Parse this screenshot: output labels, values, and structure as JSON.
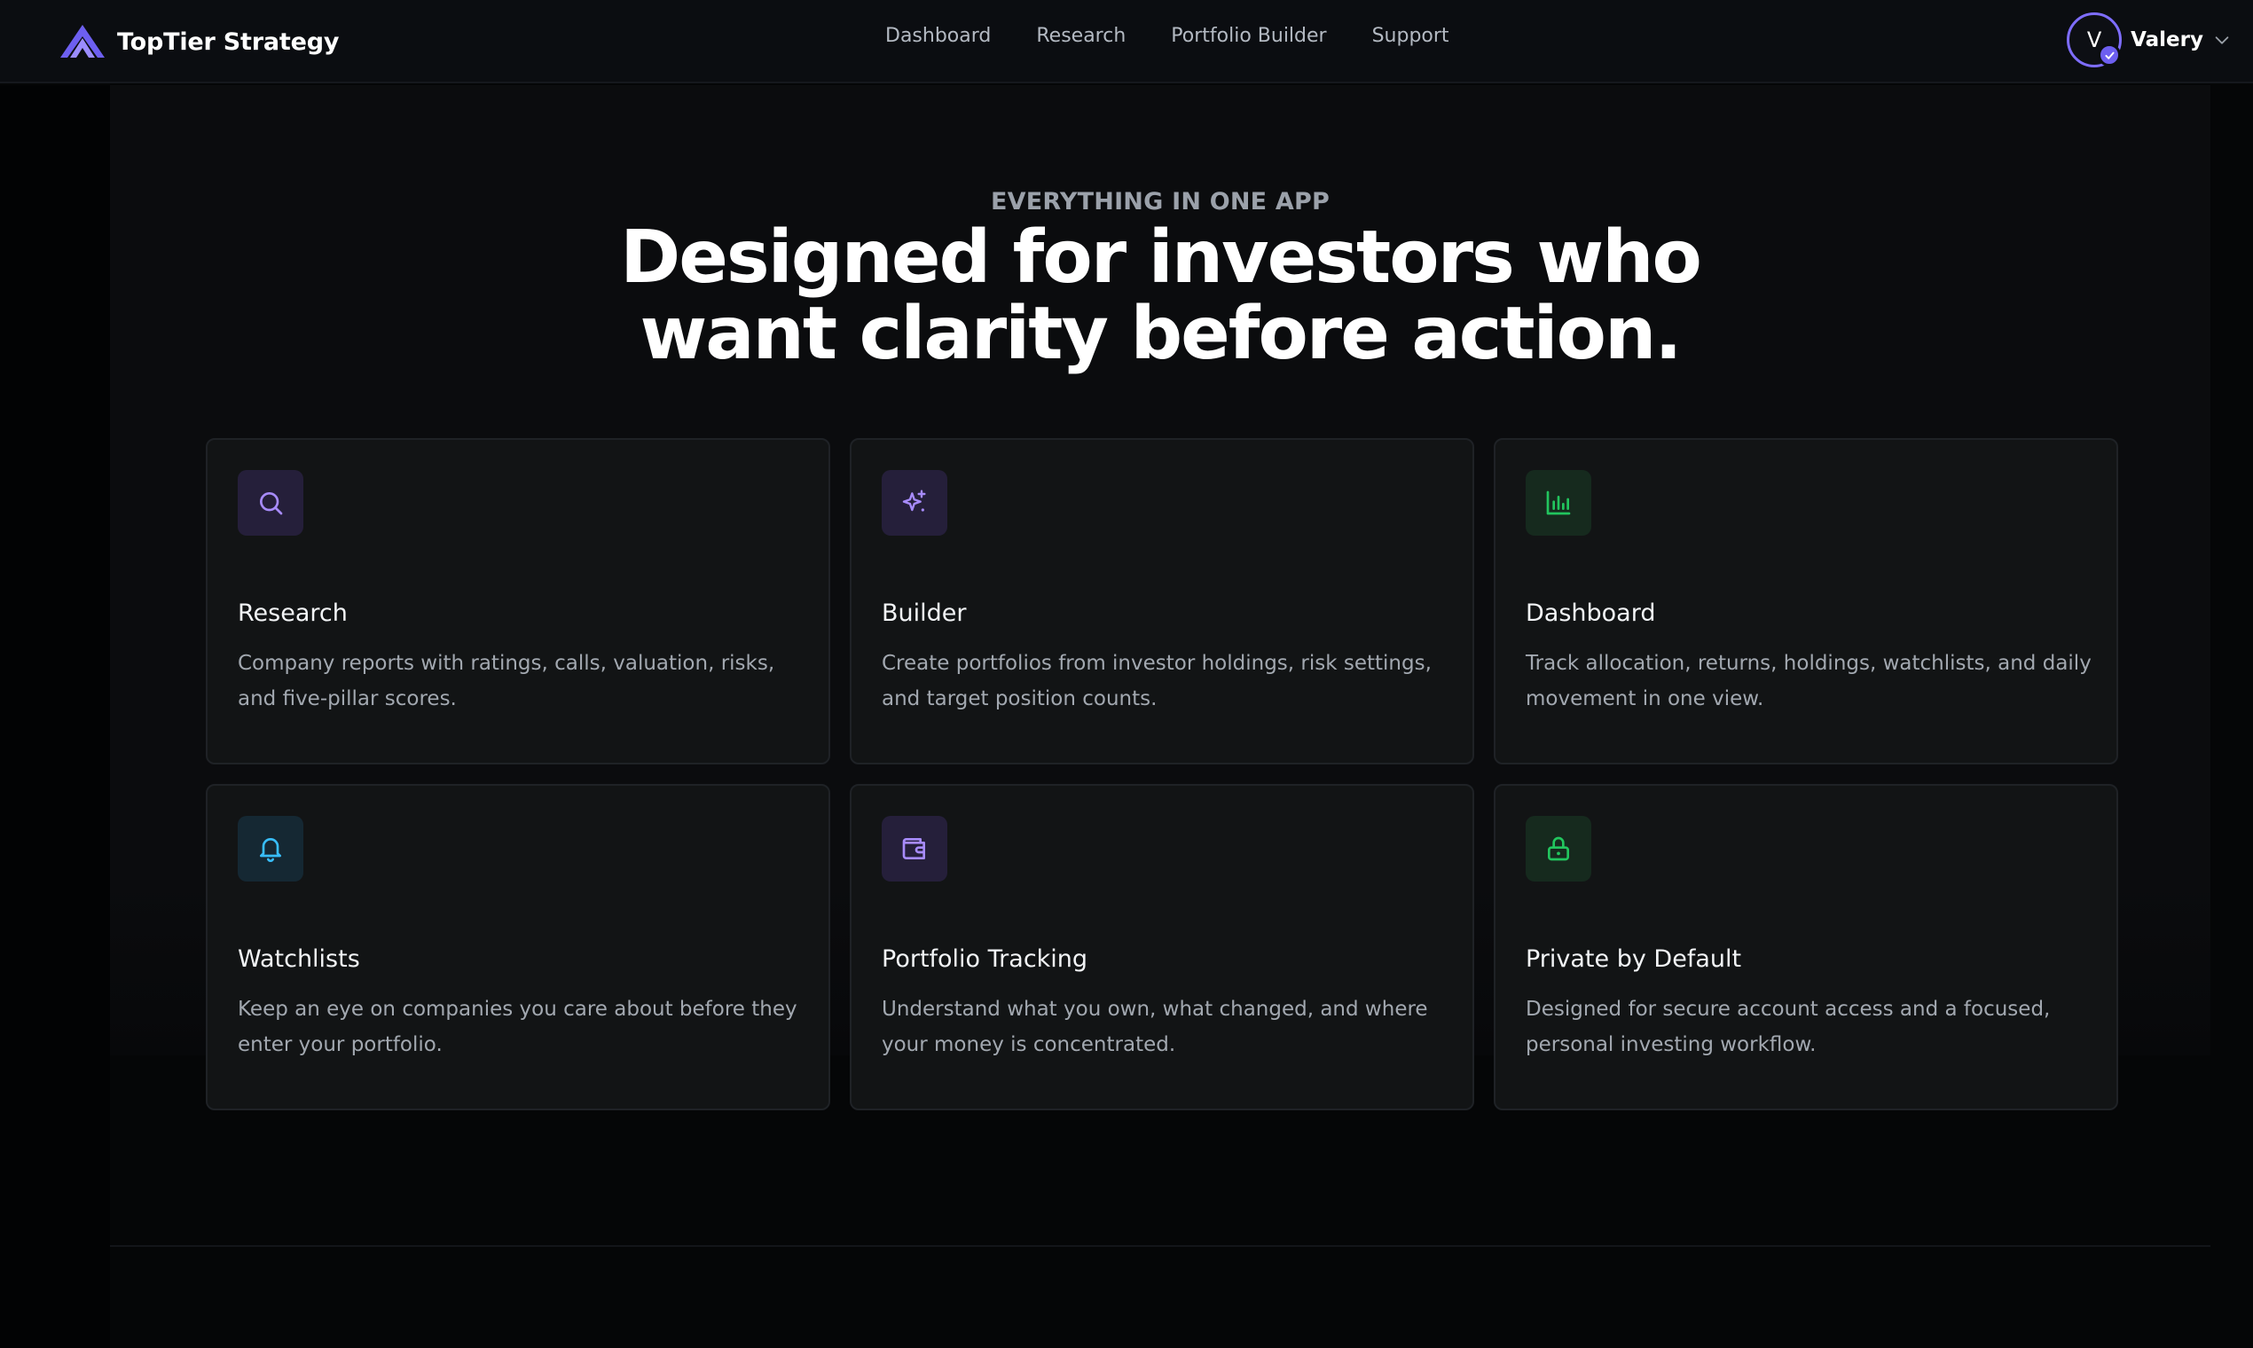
{
  "header": {
    "brand_name": "TopTier Strategy",
    "nav": [
      {
        "label": "Dashboard"
      },
      {
        "label": "Research"
      },
      {
        "label": "Portfolio Builder"
      },
      {
        "label": "Support"
      }
    ],
    "user": {
      "initial": "V",
      "name": "Valery"
    }
  },
  "hero": {
    "eyebrow": "EVERYTHING IN ONE APP",
    "headline_line1": "Designed for investors who",
    "headline_line2": "want clarity before action."
  },
  "features": [
    {
      "title": "Research",
      "desc": "Company reports with ratings, calls, valuation, risks, and five-pillar scores.",
      "icon": "search-icon"
    },
    {
      "title": "Builder",
      "desc": "Create portfolios from investor holdings, risk settings, and target position counts.",
      "icon": "sparkles-icon"
    },
    {
      "title": "Dashboard",
      "desc": "Track allocation, returns, holdings, watchlists, and daily movement in one view.",
      "icon": "bar-chart-icon"
    },
    {
      "title": "Watchlists",
      "desc": "Keep an eye on companies you care about before they enter your portfolio.",
      "icon": "bell-icon"
    },
    {
      "title": "Portfolio Tracking",
      "desc": "Understand what you own, what changed, and where your money is concentrated.",
      "icon": "wallet-icon"
    },
    {
      "title": "Private by Default",
      "desc": "Designed for secure account access and a focused, personal investing workflow.",
      "icon": "lock-icon"
    }
  ],
  "colors": {
    "accent_purple": "#7e6dff",
    "icon_purple": "#a78bfa",
    "icon_green": "#22c55e",
    "icon_blue": "#38bdf8"
  }
}
